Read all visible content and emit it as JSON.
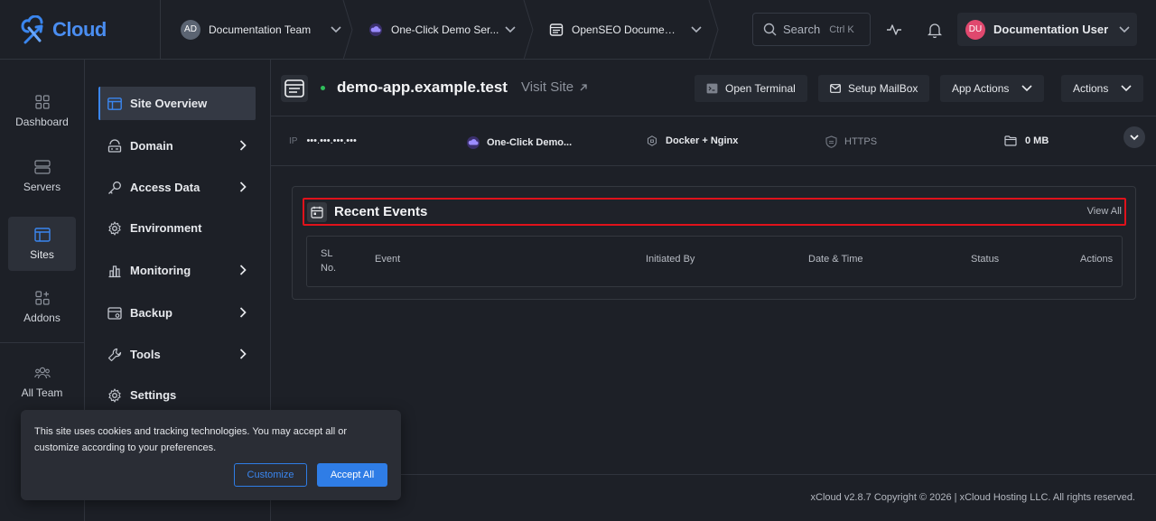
{
  "brand": {
    "logo_text": "Cloud",
    "accent": "#3a86ef"
  },
  "topbar": {
    "team": {
      "initials": "AD",
      "label": "Documentation Team"
    },
    "server": {
      "label": "One-Click Demo Ser..."
    },
    "site": {
      "label": "OpenSEO Document..."
    },
    "search": {
      "label": "Search",
      "shortcut": "Ctrl K"
    },
    "user": {
      "initials": "DU",
      "name": "Documentation User"
    }
  },
  "leftnav": [
    {
      "label": "Dashboard",
      "icon": "dashboard-icon"
    },
    {
      "label": "Servers",
      "icon": "server-icon"
    },
    {
      "label": "Sites",
      "icon": "sites-icon",
      "active": true
    },
    {
      "label": "Addons",
      "icon": "addons-icon"
    },
    {
      "label": "All Team",
      "icon": "team-icon"
    }
  ],
  "subnav": [
    {
      "label": "Site Overview",
      "icon": "site-overview-icon",
      "active": true
    },
    {
      "label": "Domain",
      "icon": "domain-icon",
      "has_children": true
    },
    {
      "label": "Access Data",
      "icon": "key-icon",
      "has_children": true
    },
    {
      "label": "Environment",
      "icon": "gear-icon"
    },
    {
      "label": "Monitoring",
      "icon": "chart-icon",
      "has_children": true
    },
    {
      "label": "Backup",
      "icon": "backup-icon",
      "has_children": true
    },
    {
      "label": "Tools",
      "icon": "wrench-icon",
      "has_children": true
    },
    {
      "label": "Settings",
      "icon": "settings-icon"
    }
  ],
  "site": {
    "name": "demo-app.example.test",
    "status": "online",
    "visit_label": "Visit Site",
    "buttons": {
      "terminal": "Open Terminal",
      "mailbox": "Setup MailBox",
      "app_actions": "App Actions",
      "actions": "Actions"
    }
  },
  "info": {
    "ip_label": "IP",
    "ip_value": "•••.•••.•••.•••",
    "server": "One-Click Demo...",
    "stack": "Docker + Nginx",
    "https": "HTTPS",
    "size": "0 MB"
  },
  "events": {
    "title": "Recent Events",
    "view_all": "View All",
    "columns": {
      "sl_line1": "SL",
      "sl_line2": "No.",
      "event": "Event",
      "initiated_by": "Initiated By",
      "date_time": "Date & Time",
      "status": "Status",
      "actions": "Actions"
    },
    "rows": []
  },
  "footer": {
    "text": "xCloud v2.8.7 Copyright © 2026 | xCloud Hosting LLC. All rights reserved."
  },
  "cookie": {
    "text": "This site uses cookies and tracking technologies. You may accept all or customize according to your preferences.",
    "customize": "Customize",
    "accept": "Accept All"
  }
}
